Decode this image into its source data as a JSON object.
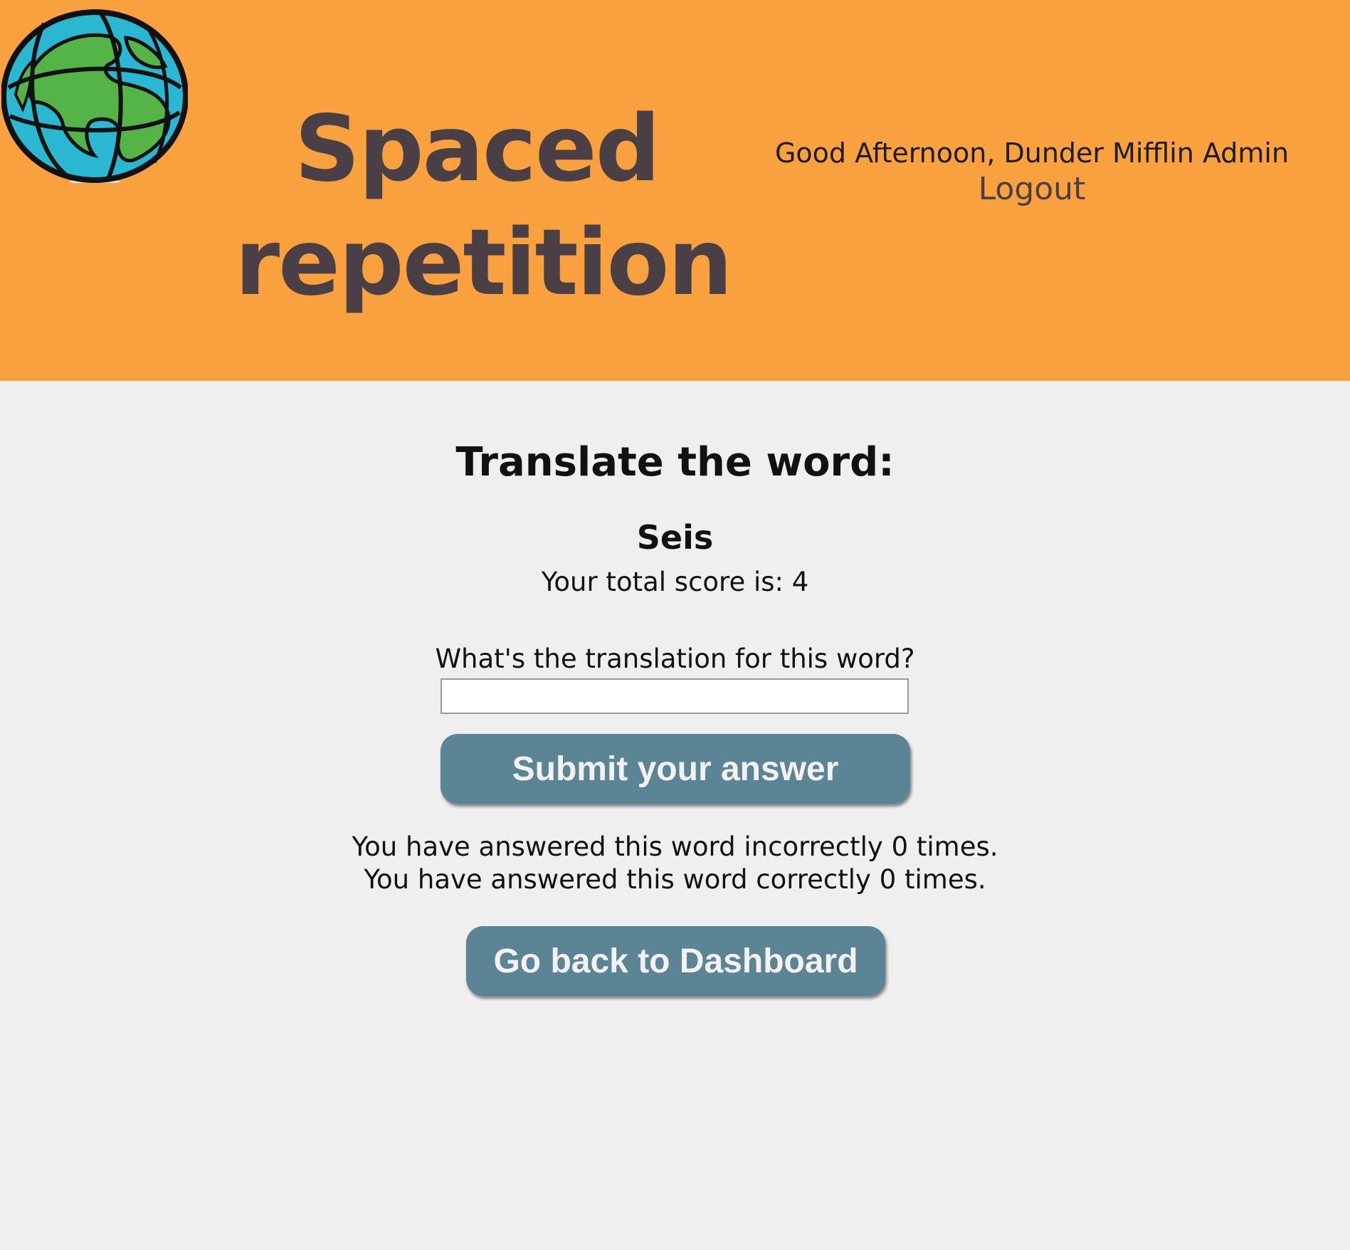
{
  "header": {
    "logo_icon": "globe-icon",
    "title": "Spaced repetition",
    "greeting": "Good Afternoon, Dunder Mifflin Admin",
    "logout_label": "Logout",
    "background_color": "#f9a13f",
    "text_color": "#4b3f46"
  },
  "learning": {
    "heading": "Translate the word:",
    "word": "Seis",
    "score_text": "Your total score is: 4",
    "input_label": "What's the translation for this word?",
    "input_value": "",
    "submit_label": "Submit your answer",
    "incorrect_text": "You have answered this word incorrectly 0 times.",
    "correct_text": "You have answered this word correctly 0 times.",
    "dashboard_label": "Go back to Dashboard",
    "button_color": "#5b8494"
  }
}
